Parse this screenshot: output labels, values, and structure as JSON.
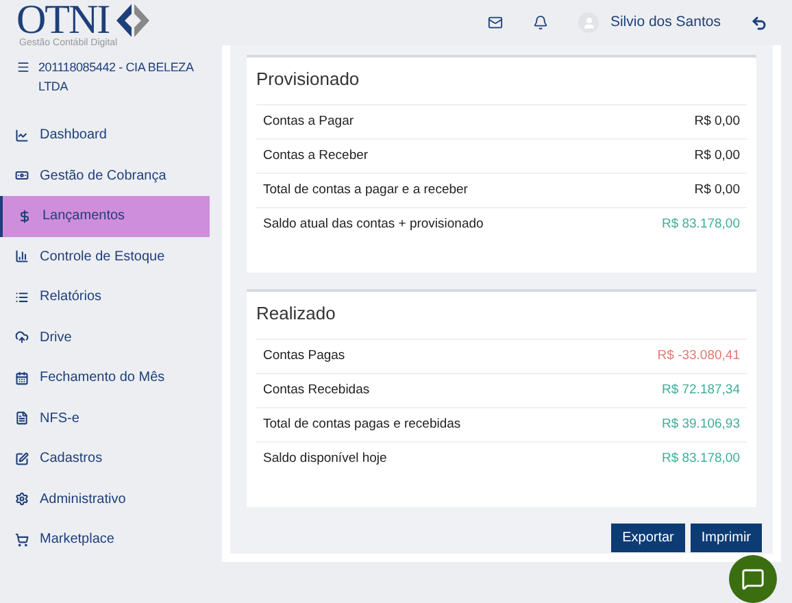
{
  "logo": {
    "name": "OTNI",
    "tagline": "Gestão Contábil Digital"
  },
  "company": "201118085442 - CIA BELEZA LTDA",
  "menu": [
    {
      "label": "Dashboard",
      "selected": false
    },
    {
      "label": "Gestão de Cobrança",
      "selected": false
    },
    {
      "label": "Lançamentos",
      "selected": true
    },
    {
      "label": "Controle de Estoque",
      "selected": false
    },
    {
      "label": "Relatórios",
      "selected": false
    },
    {
      "label": "Drive",
      "selected": false
    },
    {
      "label": "Fechamento do Mês",
      "selected": false
    },
    {
      "label": "NFS-e",
      "selected": false
    },
    {
      "label": "Cadastros",
      "selected": false
    },
    {
      "label": "Administrativo",
      "selected": false
    },
    {
      "label": "Marketplace",
      "selected": false
    }
  ],
  "header": {
    "user": "Silvio dos Santos"
  },
  "sections": [
    {
      "title": "Provisionado",
      "rows": [
        {
          "label": "Contas a Pagar",
          "value": "R$ 0,00",
          "color": "#222222"
        },
        {
          "label": "Contas a Receber",
          "value": "R$ 0,00",
          "color": "#222222"
        },
        {
          "label": "Total de contas a pagar e a receber",
          "value": "R$ 0,00",
          "color": "#222222"
        },
        {
          "label": "Saldo atual das contas + provisionado",
          "value": "R$ 83.178,00",
          "color": "#3fae97"
        }
      ]
    },
    {
      "title": "Realizado",
      "rows": [
        {
          "label": "Contas Pagas",
          "value": "R$ -33.080,41",
          "color": "#e07a72"
        },
        {
          "label": "Contas Recebidas",
          "value": "R$ 72.187,34",
          "color": "#3fae97"
        },
        {
          "label": "Total de contas pagas e recebidas",
          "value": "R$ 39.106,93",
          "color": "#3fae97"
        },
        {
          "label": "Saldo disponível hoje",
          "value": "R$ 83.178,00",
          "color": "#3fae97"
        }
      ]
    }
  ],
  "buttons": [
    "Exportar",
    "Imprimir"
  ]
}
